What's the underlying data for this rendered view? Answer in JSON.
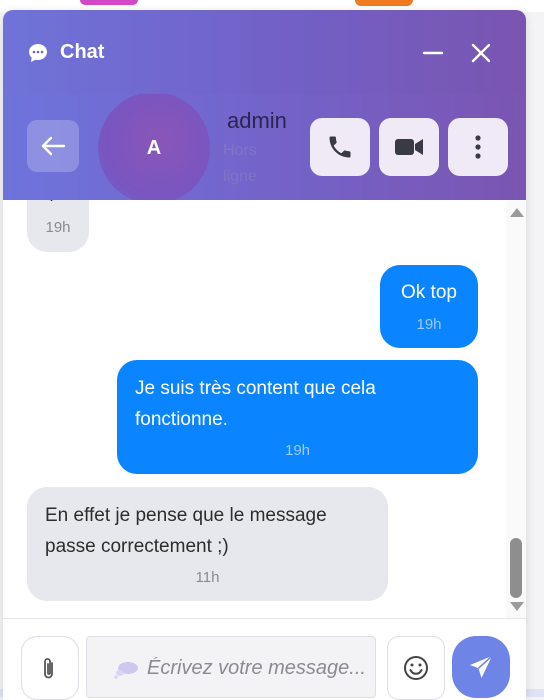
{
  "header": {
    "title": "Chat"
  },
  "contact": {
    "avatar_initial": "A",
    "name": "admin",
    "status": "Hors ligne"
  },
  "messages": [
    {
      "direction": "in",
      "text": ":)",
      "time": "19h"
    },
    {
      "direction": "out",
      "text": "Ok top",
      "time": "19h"
    },
    {
      "direction": "out",
      "text": "Je suis très content que cela fonctionne.",
      "time": "19h"
    },
    {
      "direction": "in",
      "text": "En effet je pense que le message passe correctement ;)",
      "time": "11h"
    }
  ],
  "composer": {
    "placeholder": "Écrivez votre message..."
  },
  "colors": {
    "header_gradient_start": "#6f73d8",
    "header_gradient_end": "#7a55b0",
    "outgoing_bubble": "#0a84ff",
    "incoming_bubble": "#e7e8ed",
    "send_button": "#6e84e6"
  },
  "icons": [
    "chat-bubble-icon",
    "minimize-icon",
    "close-icon",
    "back-arrow-icon",
    "phone-icon",
    "video-icon",
    "more-vertical-icon",
    "paperclip-icon",
    "thought-bubble-icon",
    "smiley-icon",
    "send-icon"
  ]
}
